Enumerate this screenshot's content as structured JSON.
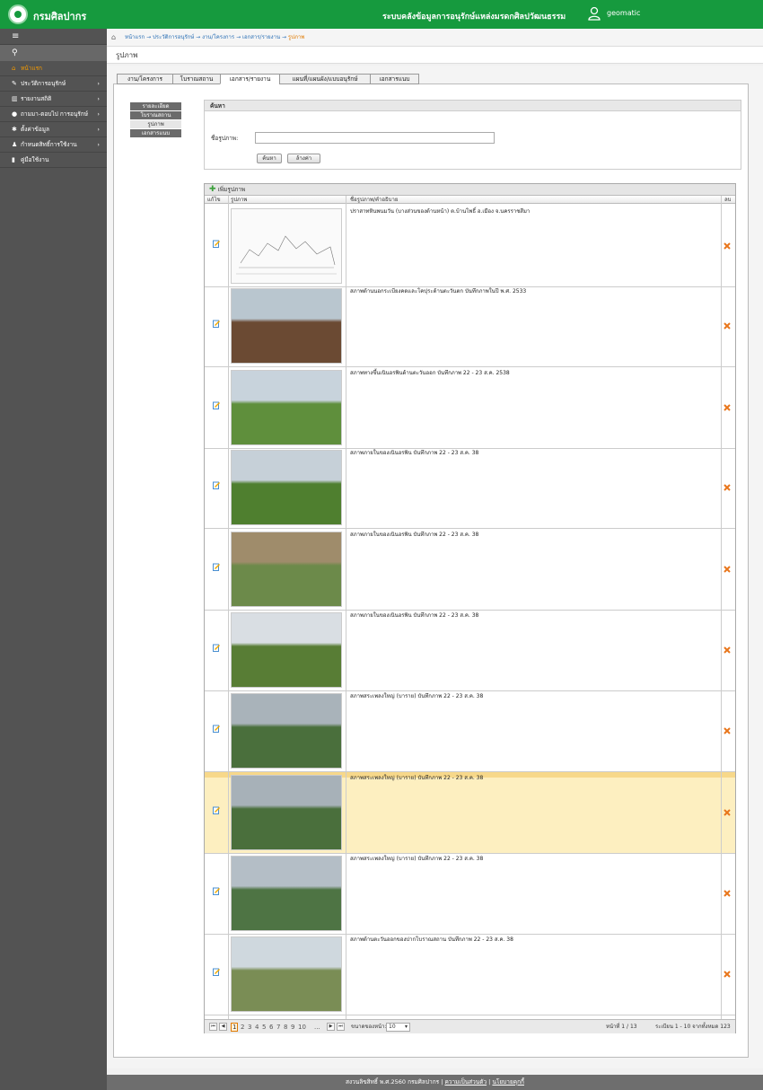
{
  "header": {
    "brand": "กรมศิลปากร",
    "system_title": "ระบบคลังข้อมูลการอนุรักษ์แหล่งมรดกศิลปวัฒนธรรม",
    "username": "geomatic"
  },
  "sidebar": {
    "menu_icon": "hamburger-icon",
    "search_icon": "search-icon",
    "items": [
      {
        "label": "หน้าแรก",
        "icon": "home-icon"
      },
      {
        "label": "ประวัติการอนุรักษ์",
        "icon": "edit-icon"
      },
      {
        "label": "รายงานสถิติ",
        "icon": "bar-chart-icon"
      },
      {
        "label": "ถามมา-ตอบไป การอนุรักษ์",
        "icon": "chat-icon"
      },
      {
        "label": "ตั้งค่าข้อมูล",
        "icon": "gear-icon"
      },
      {
        "label": "กำหนดสิทธิ์การใช้งาน",
        "icon": "user-icon"
      },
      {
        "label": "คู่มือใช้งาน",
        "icon": "book-icon"
      }
    ]
  },
  "breadcrumb": {
    "items": [
      "หน้าแรก",
      "ประวัติการอนุรักษ์",
      "งาน/โครงการ",
      "เอกสาร/รายงาน"
    ],
    "current": "รูปภาพ"
  },
  "page_title": "รูปภาพ",
  "tabs": [
    "งาน/โครงการ",
    "โบราณสถาน",
    "เอกสาร/รายงาน",
    "แผนที่/แผนผัง/แบบอนุรักษ์",
    "เอกสารแนบ"
  ],
  "side_tabs": [
    "รายละเอียด",
    "โบราณสถาน",
    "รูปภาพ",
    "เอกสารแนบ"
  ],
  "search": {
    "title": "ค้นหา",
    "label": "ชื่อรูปภาพ:",
    "value": "",
    "search_button": "ค้นหา",
    "clear_button": "ล้างค่า"
  },
  "grid": {
    "add_label": "เพิ่มรูปภาพ",
    "columns": [
      "แก้ไข",
      "รูปภาพ",
      "ชื่อรูปภาพ/คำอธิบาย",
      "ลบ"
    ],
    "rows": [
      {
        "desc": "ปราสาทหินพนมวัน (บางส่วนของด้านหน้า) ต.บ้านโพธิ์ อ.เมือง จ.นครราชสีมา"
      },
      {
        "desc": "สภาพด้านนอกระเบียงคดและโคปุระด้านตะวันตก บันทึกภาพในปี พ.ศ. 2533"
      },
      {
        "desc": "สภาพทางขึ้นเนินอรพินด้านตะวันออก บันทึกภาพ 22 - 23 ส.ค. 2538"
      },
      {
        "desc": "สภาพภายในของเนินอรพิน บันทึกภาพ 22 - 23 ส.ค. 38"
      },
      {
        "desc": "สภาพภายในของเนินอรพิน บันทึกภาพ 22 - 23 ส.ค. 38"
      },
      {
        "desc": "สภาพภายในของเนินอรพิน บันทึกภาพ 22 - 23 ส.ค. 38"
      },
      {
        "desc": "สภาพสระเพลงใหญ่ (บาราย) บันทึกภาพ 22 - 23 ส.ค. 38"
      },
      {
        "desc": "สภาพสระเพลงใหญ่ (บาราย) บันทึกภาพ 22 - 23 ส.ค. 38"
      },
      {
        "desc": "สภาพสระเพลงใหญ่ (บาราย) บันทึกภาพ 22 - 23 ส.ค. 38"
      },
      {
        "desc": "สภาพด้านตะวันออกของปากโบราณสถาน บันทึกภาพ 22 - 23 ส.ค. 38"
      }
    ]
  },
  "pager": {
    "pages": [
      "1",
      "2",
      "3",
      "4",
      "5",
      "6",
      "7",
      "8",
      "9",
      "10",
      "..."
    ],
    "current_page": "1",
    "page_size_label": "ขนาดของหน้า:",
    "page_size": "10",
    "page_info": "หน้าที่ 1 / 13",
    "record_info": "ระเบียน 1 - 10 จากทั้งหมด 123"
  },
  "footer": {
    "copyright": "สงวนลิขสิทธิ์ พ.ศ.2560 กรมศิลปากร",
    "link1": "ความเป็นส่วนตัว",
    "link2": "นโยบายคุกกี้"
  },
  "colors": {
    "header_green": "#169a3e",
    "sidebar": "#535353",
    "active_orange": "#f29900",
    "highlight_row": "#fdefc0"
  }
}
